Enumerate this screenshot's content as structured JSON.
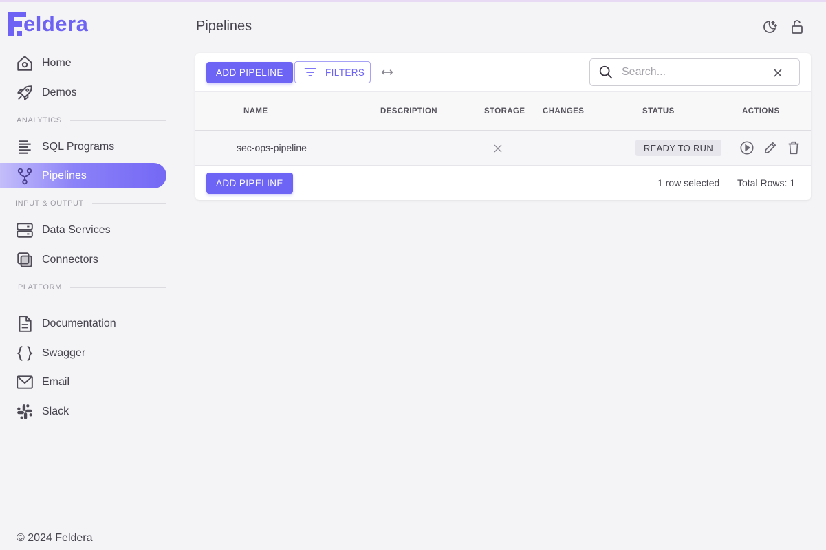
{
  "brand": {
    "name": "eldera",
    "accent": "#6d63f5"
  },
  "sidebar": {
    "items": [
      {
        "label": "Home",
        "icon": "home-icon"
      },
      {
        "label": "Demos",
        "icon": "rocket-icon"
      },
      {
        "label": "SQL Programs",
        "icon": "text-lines-icon"
      },
      {
        "label": "Pipelines",
        "icon": "pipeline-branch-icon",
        "active": true
      },
      {
        "label": "Data Services",
        "icon": "server-icon"
      },
      {
        "label": "Connectors",
        "icon": "connectors-icon"
      },
      {
        "label": "Documentation",
        "icon": "document-icon"
      },
      {
        "label": "Swagger",
        "icon": "braces-icon"
      },
      {
        "label": "Email",
        "icon": "email-icon"
      },
      {
        "label": "Slack",
        "icon": "slack-icon"
      }
    ],
    "sections": [
      "ANALYTICS",
      "INPUT & OUTPUT",
      "PLATFORM"
    ],
    "footer": "© 2024 Feldera"
  },
  "header": {
    "title": "Pipelines"
  },
  "toolbar": {
    "add_label": "ADD PIPELINE",
    "filters_label": "FILTERS",
    "search_placeholder": "Search..."
  },
  "table": {
    "columns": [
      "NAME",
      "DESCRIPTION",
      "STORAGE",
      "CHANGES",
      "STATUS",
      "ACTIONS"
    ],
    "rows": [
      {
        "name": "sec-ops-pipeline",
        "description": "",
        "storage": "none",
        "changes": "",
        "status": "READY TO RUN"
      }
    ]
  },
  "footer_bar": {
    "add_label": "ADD PIPELINE",
    "selected": "1 row selected",
    "total": "Total Rows: 1"
  }
}
